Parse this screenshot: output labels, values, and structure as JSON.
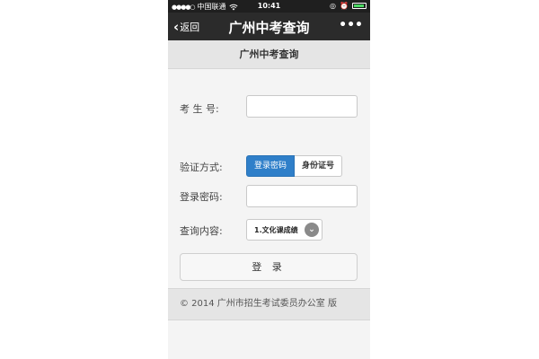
{
  "statusbar": {
    "signal_dots": "●●●●○",
    "carrier": "中国联通",
    "wifi_icon": "wifi-icon",
    "time": "10:41",
    "alarm_icon": "◎",
    "lock_icon": "⏰",
    "battery_icon": "battery-icon",
    "battery_color": "#4cd964"
  },
  "navbar": {
    "back_chevron": "‹",
    "back_label": "返回",
    "title": "广州中考查询",
    "more": "•••"
  },
  "band": {
    "title": "广州中考查询"
  },
  "form": {
    "exam_no_label": "考 生 号:",
    "exam_no_value": "",
    "verify_label": "验证方式:",
    "verify_options": [
      "登录密码",
      "身份证号"
    ],
    "verify_selected": "登录密码",
    "password_label": "登录密码:",
    "password_value": "",
    "query_label": "查询内容:",
    "query_selected": "1.文化课成绩",
    "query_caret": "⌄",
    "login_button": "登 录"
  },
  "footer": {
    "text": "© 2014 广州市招生考试委员办公室 版"
  },
  "colors": {
    "active_accent": "#2f7fc9",
    "navbar_bg": "#2b2b2b",
    "statusbar_bg": "#1f1f1f",
    "band_bg": "#e5e5e5"
  }
}
